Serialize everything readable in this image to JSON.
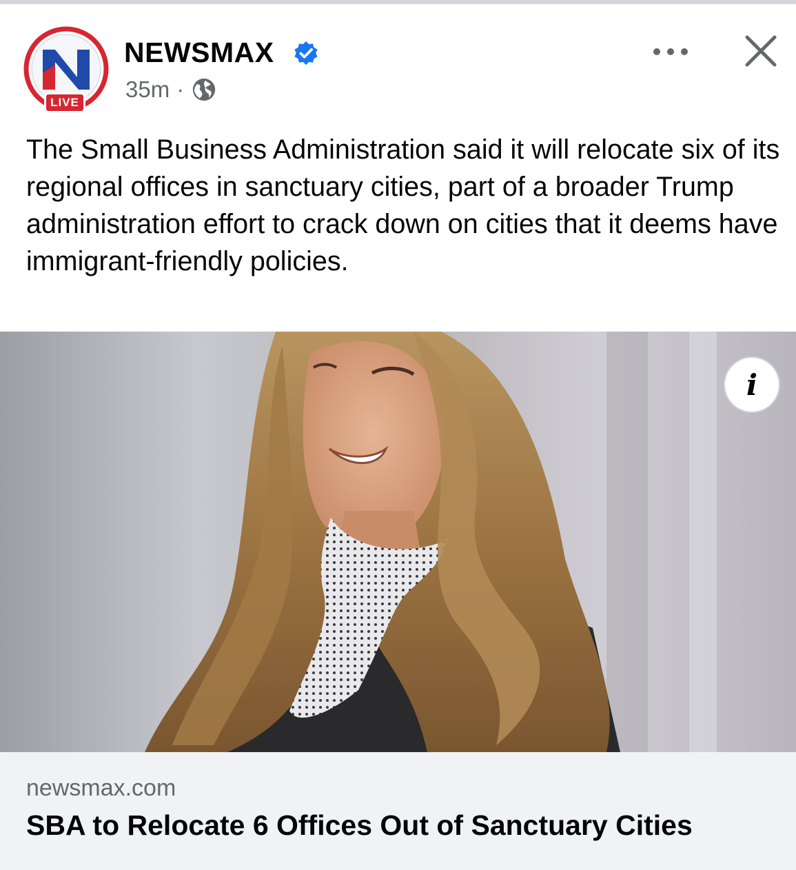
{
  "header": {
    "page_name": "NEWSMAX",
    "timestamp": "35m",
    "separator": "·",
    "live_badge": "LIVE",
    "logo_letter": "N",
    "verified": true,
    "privacy": "globe-icon"
  },
  "post": {
    "text": "The Small Business Administration said it will relocate six of its regional offices in sanctuary cities, part of a broader Trump administration effort to crack down on cities that it deems have immigrant-friendly policies."
  },
  "media": {
    "info_label": "i"
  },
  "link": {
    "domain": "newsmax.com",
    "title": "SBA to Relocate 6 Offices Out of Sanctuary Cities"
  },
  "colors": {
    "brand_red": "#d72631",
    "brand_blue": "#1f4aa8",
    "verified_blue": "#1877f2",
    "secondary_text": "#65676b",
    "card_bg": "#f0f2f5"
  }
}
